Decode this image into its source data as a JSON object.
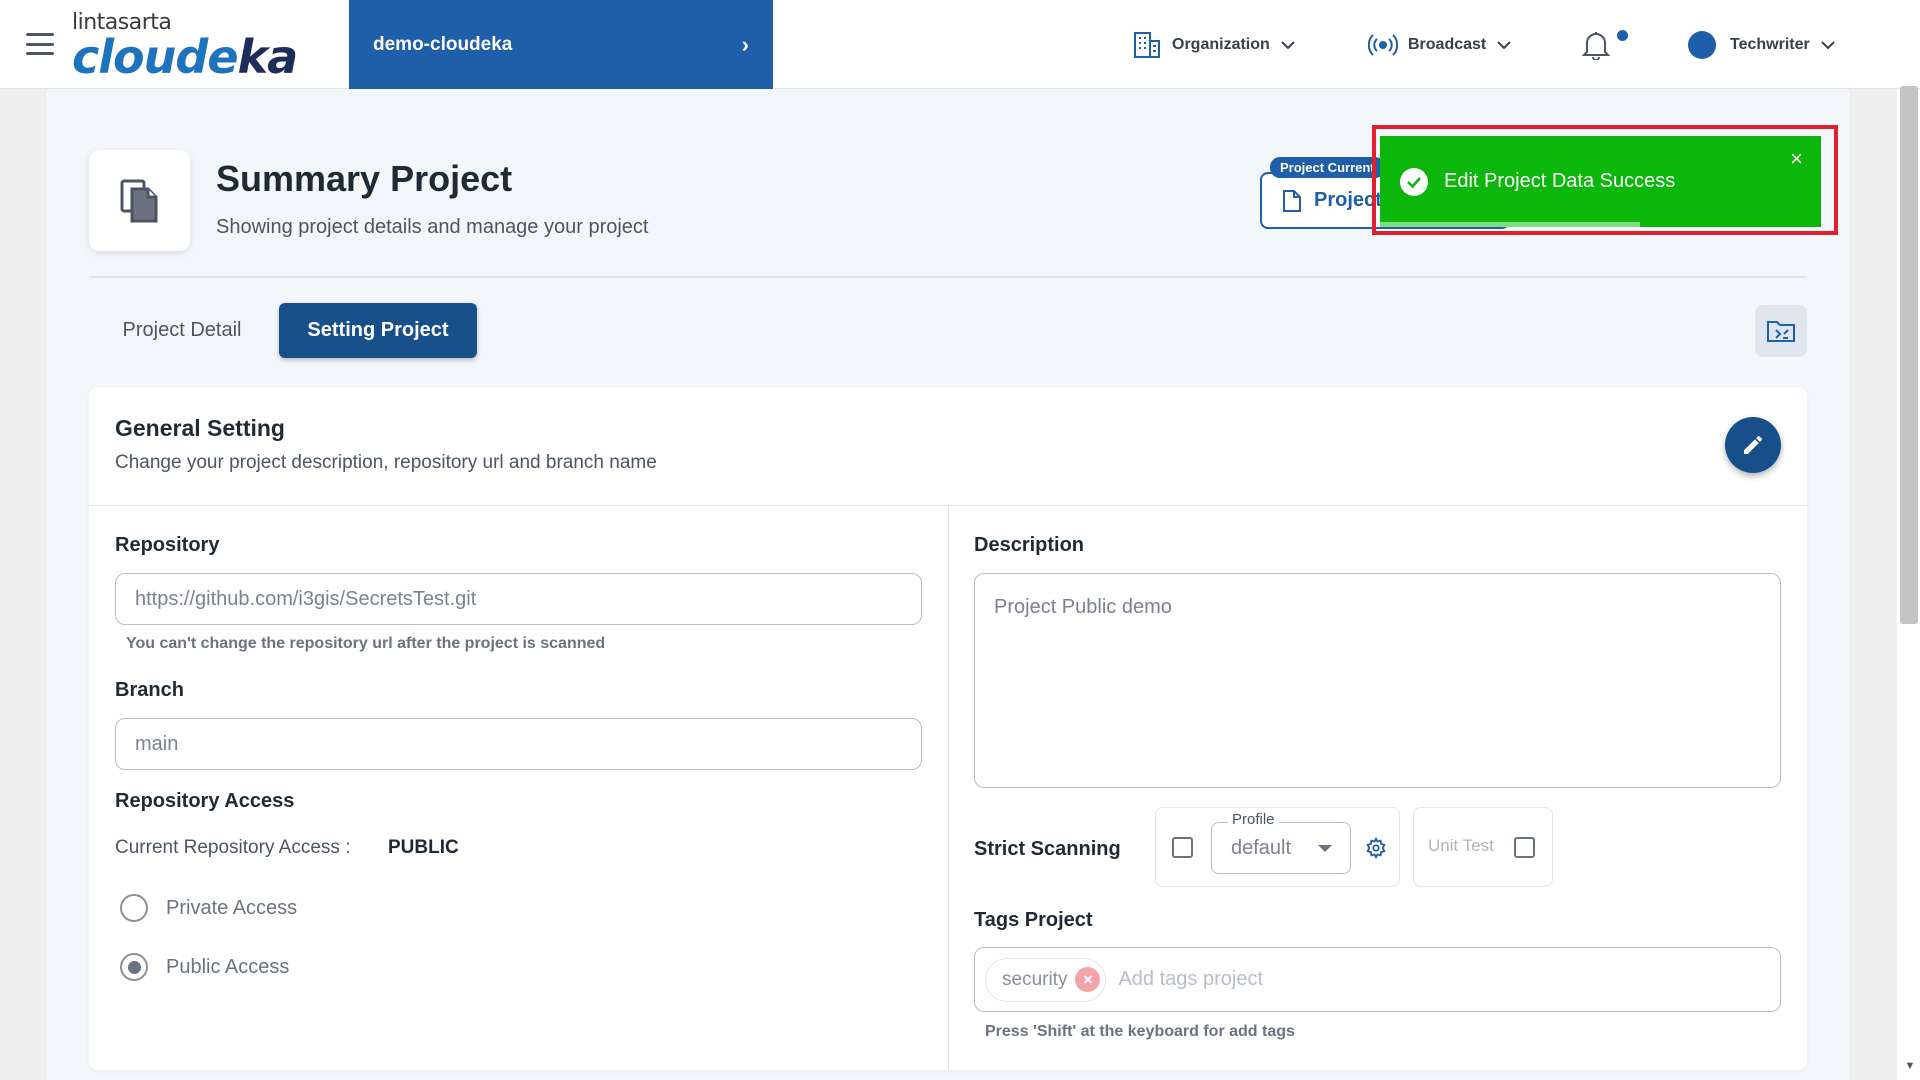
{
  "header": {
    "logo_top": "lintasarta",
    "logo_main_a": "cloude",
    "logo_main_b": "ka",
    "project_switch": "demo-cloudeka",
    "nav": {
      "organization": "Organization",
      "broadcast": "Broadcast",
      "user": "Techwriter"
    }
  },
  "page": {
    "title": "Summary Project",
    "subtitle": "Showing project details and manage your project",
    "project_current_badge": "Project Current",
    "project_current_value": "Project"
  },
  "tabs": [
    {
      "label": "Project Detail",
      "active": false
    },
    {
      "label": "Setting Project",
      "active": true
    }
  ],
  "general_setting": {
    "title": "General Setting",
    "subtitle": "Change your project description, repository url and branch name",
    "repository": {
      "label": "Repository",
      "value": "https://github.com/i3gis/SecretsTest.git",
      "hint": "You can't change the repository url after the project is scanned"
    },
    "branch": {
      "label": "Branch",
      "value": "main"
    },
    "repository_access": {
      "label": "Repository Access",
      "current_label": "Current Repository Access :",
      "current_value": "PUBLIC",
      "options": [
        {
          "label": "Private Access",
          "selected": false
        },
        {
          "label": "Public Access",
          "selected": true
        }
      ]
    },
    "description": {
      "label": "Description",
      "value": "Project Public demo"
    },
    "strict_scanning": {
      "label": "Strict Scanning",
      "checked": false,
      "profile_legend": "Profile",
      "profile_value": "default",
      "unit_test_label": "Unit Test",
      "unit_test_checked": false
    },
    "tags": {
      "label": "Tags Project",
      "chips": [
        "security"
      ],
      "placeholder": "Add tags project",
      "hint": "Press 'Shift' at the keyboard for add tags"
    }
  },
  "toast": {
    "message": "Edit Project Data Success",
    "close": "×",
    "progress": 0.59
  },
  "colors": {
    "primary": "#1f5ea8",
    "tab_active": "#174f8a",
    "toast_bg": "#0cb70c",
    "highlight": "#e0202d"
  }
}
